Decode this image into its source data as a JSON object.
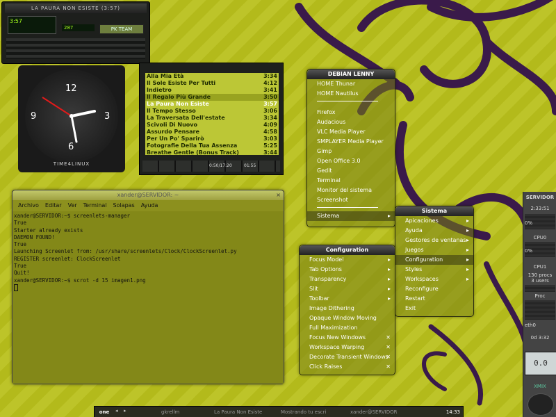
{
  "audacious": {
    "title": "LA PAURA NON ESISTE (3:57)",
    "time": "3:57",
    "lcd_small": "287",
    "button_label": "PK TEAM"
  },
  "clock": {
    "numbers": [
      "12",
      "3",
      "6",
      "9"
    ],
    "brand": "TIME4LINUX"
  },
  "playlist": {
    "tracks": [
      {
        "title": "Alla Mia Età",
        "time": "3:34"
      },
      {
        "title": "Il Sole Esiste Per Tutti",
        "time": "4:12"
      },
      {
        "title": "Indietro",
        "time": "3:41"
      },
      {
        "title": "Il Regalo Più Grande",
        "time": "3:50"
      },
      {
        "title": "La Paura Non Esiste",
        "time": "3:57"
      },
      {
        "title": "Il Tempo Stesso",
        "time": "3:06"
      },
      {
        "title": "La Traversata Dell'estate",
        "time": "3:34"
      },
      {
        "title": "Scivoli Di Nuovo",
        "time": "4:09"
      },
      {
        "title": "Assurdo Pensare",
        "time": "4:58"
      },
      {
        "title": "Per Un Po' Sparirò",
        "time": "3:03"
      },
      {
        "title": "Fotografie Della Tua Assenza",
        "time": "5:25"
      },
      {
        "title": "Breathe Gentle (Bonus Track)",
        "time": "3:44"
      }
    ],
    "footer_time": "0:50/17:20",
    "footer_pos": "01:55"
  },
  "terminal": {
    "title": "xander@SERVIDOR: ~",
    "close": "×",
    "menu": [
      "Archivo",
      "Editar",
      "Ver",
      "Terminal",
      "Solapas",
      "Ayuda"
    ],
    "lines": [
      "xander@SERVIDOR:~$ screenlets-manager",
      "True",
      "Starter already exists",
      "DAEMON FOUND!",
      "True",
      "Launching Screenlet from: /usr/share/screenlets/Clock/ClockScreenlet.py",
      "REGISTER screenlet: ClockScreenlet",
      "True",
      "Quit!",
      "xander@SERVIDOR:~$ scrot -d 15 imagen1.png"
    ]
  },
  "debian_menu": {
    "title": "DEBIAN LENNY",
    "group1": [
      "HOME Thunar",
      "HOME Nautilus"
    ],
    "group2": [
      "Firefox",
      "Audacious",
      "VLC Media Player",
      "SMPLAYER Media Player",
      "Gimp",
      "Open Office 3.0",
      "Gedit",
      "Terminal",
      "Monitor del sistema",
      "Screenshot"
    ],
    "sistema": "Sistema",
    "arrow": "▸"
  },
  "sistema_menu": {
    "title": "Sistema",
    "items": [
      "Apicaciones",
      "Ayuda",
      "Gestores de ventanas",
      "Juegos",
      "Configuration",
      "Styles",
      "Workspaces",
      "Reconfigure",
      "Restart",
      "Exit"
    ],
    "arrow": "▸"
  },
  "config_menu": {
    "title": "Configuration",
    "items": [
      {
        "label": "Focus Model",
        "mark": "▸"
      },
      {
        "label": "Tab Options",
        "mark": "▸"
      },
      {
        "label": "Transparency",
        "mark": "▸"
      },
      {
        "label": "Slit",
        "mark": "▸"
      },
      {
        "label": "Toolbar",
        "mark": "▸"
      },
      {
        "label": "Image Dithering",
        "mark": ""
      },
      {
        "label": "Opaque Window Moving",
        "mark": ""
      },
      {
        "label": "Full Maximization",
        "mark": ""
      },
      {
        "label": "Focus New Windows",
        "mark": "✕"
      },
      {
        "label": "Workspace Warping",
        "mark": "✕"
      },
      {
        "label": "Decorate Transient Windows",
        "mark": "✕"
      },
      {
        "label": "Click Raises",
        "mark": "✕"
      }
    ]
  },
  "gkrellm": {
    "host": "SERVIDOR",
    "time": "2:33:51",
    "cpu_pct": "0%",
    "cpu0": "CPU0",
    "cpu0_pct": "0%",
    "cpu1": "CPU1",
    "procs": "130 procs",
    "users": "3 users",
    "proc": "Proc",
    "eth": "eth0",
    "uptime": "0d 3:32",
    "lcd": "0.0",
    "vol": "XMIX"
  },
  "taskbar": {
    "workspace": "one",
    "tasks": [
      "gkrellm",
      "La Paura Non Esiste",
      "Mostrando tu escri",
      "xander@SERVIDOR"
    ],
    "clock": "14:33"
  }
}
